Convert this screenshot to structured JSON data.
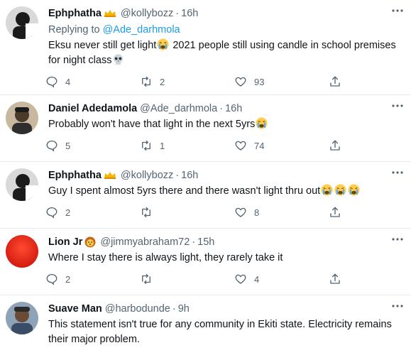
{
  "tweets": [
    {
      "name": "Ephphatha",
      "name_badge": "crown-emoji",
      "handle": "@kollybozz",
      "time": "16h",
      "avatar_color": "#1b1b1b",
      "reply_prefix": "Replying to ",
      "reply_to": "@Ade_darhmola",
      "text_parts": [
        "Eksu never still get light",
        " 2021 people still using candle in school premises for night class"
      ],
      "emoji_after": [
        "crying-face-emoji",
        "skull-emoji"
      ],
      "replies": "4",
      "retweets": "2",
      "likes": "93"
    },
    {
      "name": "Daniel Adedamola",
      "handle": "@Ade_darhmola",
      "time": "16h",
      "avatar_color": "#4a3a2a",
      "text_parts": [
        "Probably won't have that light in the next 5yrs"
      ],
      "emoji_after": [
        "crying-face-emoji"
      ],
      "replies": "5",
      "retweets": "1",
      "likes": "74"
    },
    {
      "name": "Ephphatha",
      "name_badge": "crown-emoji",
      "handle": "@kollybozz",
      "time": "16h",
      "avatar_color": "#1b1b1b",
      "text_parts": [
        "Guy I spent almost 5yrs there and there wasn't light thru out"
      ],
      "emoji_after": [
        "crying-face-emoji",
        "crying-face-emoji",
        "crying-face-emoji"
      ],
      "replies": "2",
      "retweets": "",
      "likes": "8"
    },
    {
      "name": "Lion Jr",
      "name_badge": "lion-emoji",
      "handle": "@jimmyabraham72",
      "time": "15h",
      "avatar_color": "#e0301e",
      "text_parts": [
        "Where I stay there is always light, they rarely take it"
      ],
      "replies": "2",
      "retweets": "",
      "likes": "4"
    },
    {
      "name": "Suave Man",
      "handle": "@harbodunde",
      "time": "9h",
      "avatar_color": "#3b4c66",
      "text_parts": [
        "This statement isn't true for any community in Ekiti state. Electricity remains their major problem."
      ]
    }
  ],
  "separator": "·"
}
